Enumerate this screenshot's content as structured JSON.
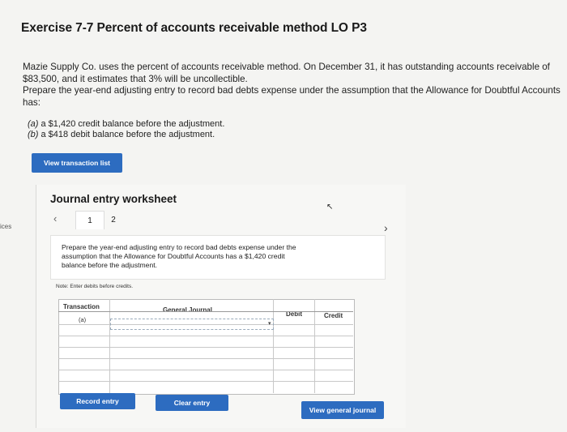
{
  "title": "Exercise 7-7 Percent of accounts receivable method LO P3",
  "intro_line1": "Mazie Supply Co. uses the percent of accounts receivable method. On December 31, it has outstanding accounts receivable of",
  "intro_line2": "$83,500, and it estimates that 3% will be uncollectible.",
  "instruction_line1": "Prepare the year-end adjusting entry to record bad debts expense under the assumption that the Allowance for Doubtful Accounts",
  "instruction_line2": "has:",
  "items": [
    {
      "marker": "(a)",
      "text": " a $1,420 credit balance before the adjustment."
    },
    {
      "marker": "(b)",
      "text": " a $418 debit balance before the adjustment."
    }
  ],
  "side_label": "ices",
  "view_transaction_list": "View transaction list",
  "worksheet": {
    "title": "Journal entry worksheet",
    "prev_icon": "chevron-left-icon",
    "next_icon": "chevron-right-icon",
    "pages": [
      "1",
      "2"
    ],
    "prompt_line1": "Prepare the year-end adjusting entry to record bad debts expense under the",
    "prompt_line2": "assumption that the Allowance for Doubtful Accounts has a $1,420 credit",
    "prompt_line3": "balance before the adjustment.",
    "note": "Note: Enter debits before credits.",
    "columns": {
      "transaction": "Transaction",
      "general_journal": "General Journal",
      "debit": "Debit",
      "credit": "Credit"
    },
    "rows": [
      {
        "transaction": "(a)",
        "account": "",
        "debit": "",
        "credit": ""
      },
      {
        "transaction": "",
        "account": "",
        "debit": "",
        "credit": ""
      },
      {
        "transaction": "",
        "account": "",
        "debit": "",
        "credit": ""
      },
      {
        "transaction": "",
        "account": "",
        "debit": "",
        "credit": ""
      },
      {
        "transaction": "",
        "account": "",
        "debit": "",
        "credit": ""
      },
      {
        "transaction": "",
        "account": "",
        "debit": "",
        "credit": ""
      }
    ],
    "record_entry": "Record entry",
    "clear_entry": "Clear entry",
    "view_general_journal": "View general journal"
  },
  "colors": {
    "button_blue": "#2d6cc0"
  }
}
